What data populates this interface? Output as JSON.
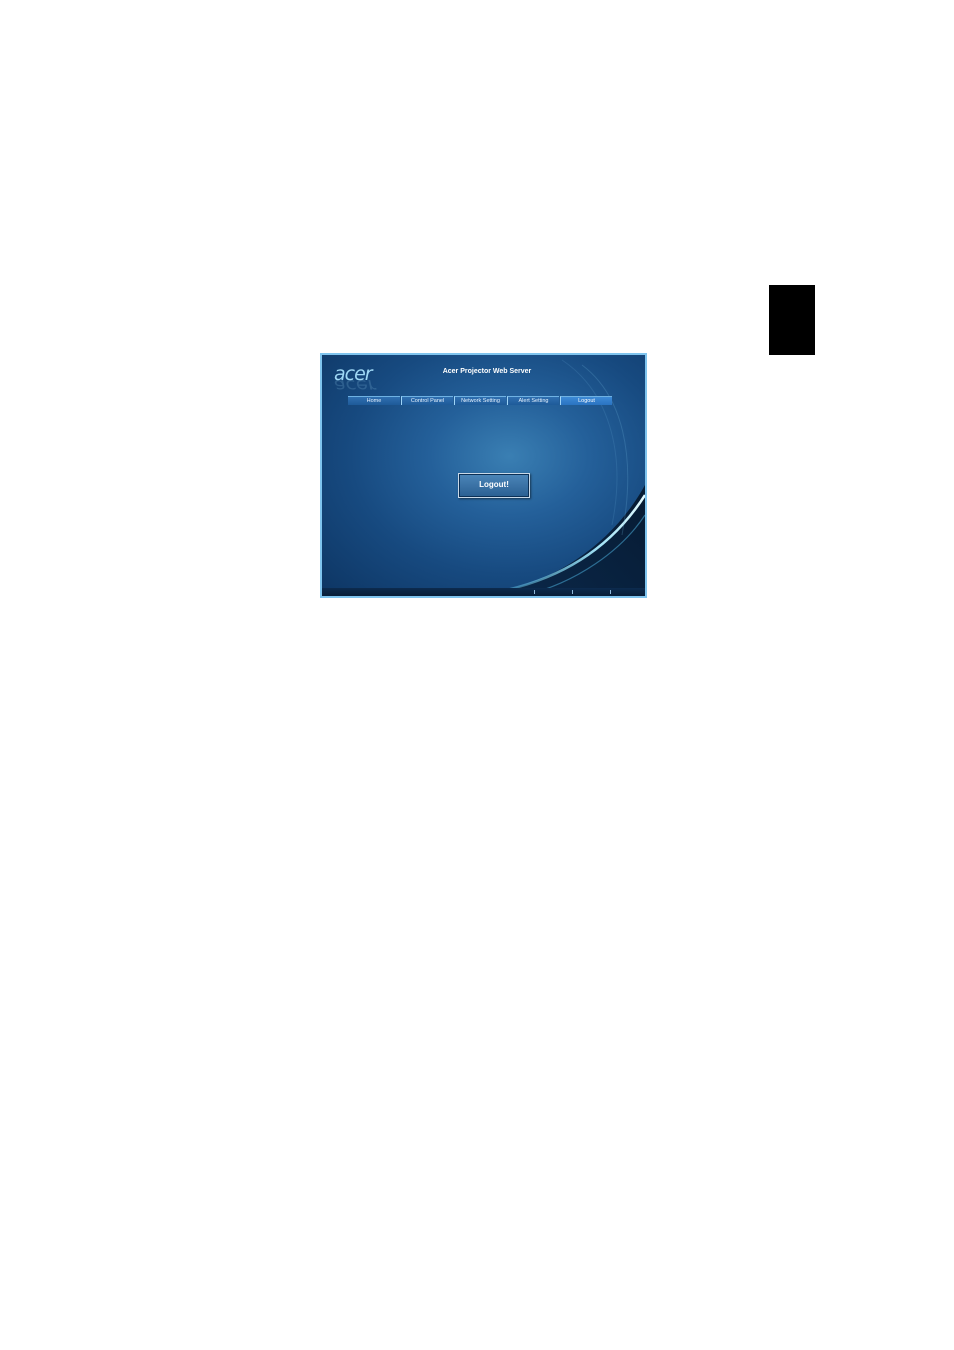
{
  "app": {
    "logo_text": "acer",
    "title": "Acer Projector Web Server"
  },
  "nav": {
    "items": [
      {
        "label": "Home"
      },
      {
        "label": "Control Panel"
      },
      {
        "label": "Network Setting"
      },
      {
        "label": "Alert Setting"
      },
      {
        "label": "Logout",
        "active": true
      }
    ]
  },
  "main": {
    "logout_button_label": "Logout!"
  },
  "colors": {
    "frame_border": "#7fc4ee",
    "background_dark": "#0d3563",
    "background_light": "#3a7fb3",
    "accent": "#9fe3ff",
    "side_tab": "#000000"
  }
}
